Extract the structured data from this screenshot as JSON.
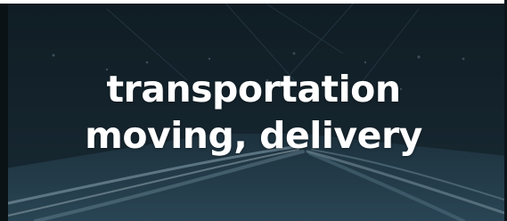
{
  "banner": {
    "line1": "transportation",
    "line2": "moving, delivery"
  },
  "colors": {
    "text": "#ffffff",
    "overlay": "#1c2a33"
  },
  "background": {
    "image": "night-highway-light-trails"
  }
}
